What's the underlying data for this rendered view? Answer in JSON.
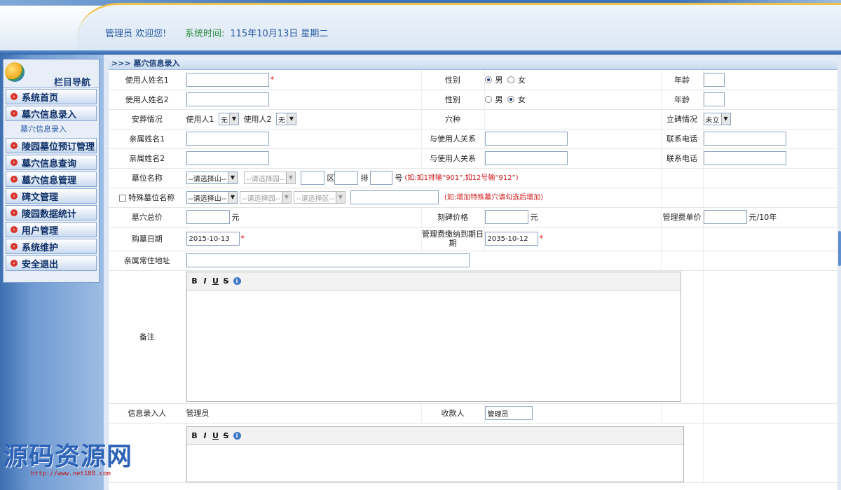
{
  "header": {
    "welcome": "管理员 欢迎您!",
    "time_label": "系统时间:",
    "time_value": "115年10月13日 星期二"
  },
  "sidebar": {
    "title": "栏目导航",
    "items": [
      {
        "label": "系统首页"
      },
      {
        "label": "墓穴信息录入"
      },
      {
        "label": "陵园墓位预订管理"
      },
      {
        "label": "墓穴信息查询"
      },
      {
        "label": "墓穴信息管理"
      },
      {
        "label": "碑文管理"
      },
      {
        "label": "陵园数据统计"
      },
      {
        "label": "用户管理"
      },
      {
        "label": "系统维护"
      },
      {
        "label": "安全退出"
      }
    ],
    "sub_item": "墓穴信息录入"
  },
  "breadcrumb": ">>> 墓穴信息录入",
  "form": {
    "user1_name_label": "使用人姓名1",
    "user2_name_label": "使用人姓名2",
    "gender_label": "性别",
    "male": "男",
    "female": "女",
    "age_label": "年龄",
    "burial_label": "安葬情况",
    "user1_label": "使用人1",
    "user2_label": "使用人2",
    "burial_user1_value": "无",
    "burial_user2_value": "无",
    "cavity_label": "穴种",
    "stele_label": "立碑情况",
    "stele_value": "未立",
    "relative1_label": "亲属姓名1",
    "relative2_label": "亲属姓名2",
    "relation_label": "与使用人关系",
    "phone_label": "联系电话",
    "plot_label": "墓位名称",
    "select_mountain": "--请选择山--",
    "select_garden": "--请选择园--",
    "select_area": "--请选择区--",
    "area_unit": "区",
    "row_unit": "排",
    "num_unit": "号",
    "plot_hint": "(如:如1排输“901”,如12号输“912”)",
    "special_label": "特殊墓位名称",
    "special_hint": "(如:增加特殊墓穴请勾选后增加)",
    "total_price_label": "墓穴总价",
    "yuan": "元",
    "carve_price_label": "刻碑价格",
    "mgmt_fee_label": "管理费单价",
    "mgmt_fee_unit": "元/10年",
    "purchase_date_label": "购墓日期",
    "purchase_date_value": "2015-10-13",
    "mgmt_due_label": "管理费缴纳到期日期",
    "mgmt_due_value": "2035-10-12",
    "address_label": "亲属常住地址",
    "remark_label": "备注",
    "entry_person_label": "信息录入人",
    "entry_person_value": "管理员",
    "payee_label": "收款人",
    "payee_value": "管理员"
  },
  "editor": {
    "bold": "B",
    "italic": "I",
    "underline": "U",
    "strike": "S",
    "info": "i"
  },
  "watermark": {
    "text": "源码资源网",
    "url": "http://www.net188.com"
  }
}
